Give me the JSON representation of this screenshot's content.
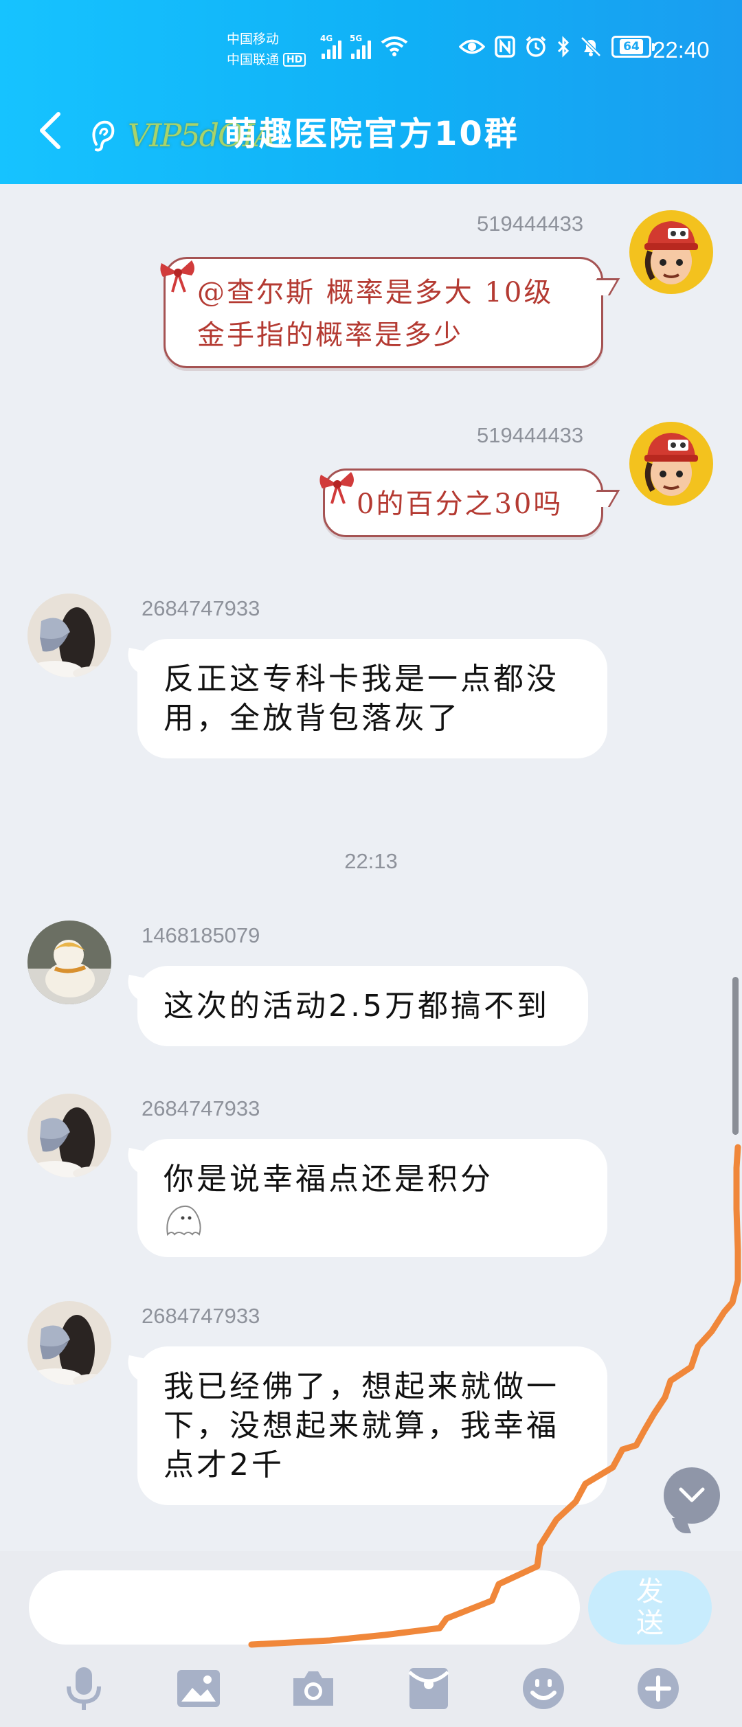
{
  "status_bar": {
    "carrier1": "中国移动",
    "carrier2": "中国联通",
    "hd": "HD",
    "net1": "4G",
    "net2": "5G",
    "battery": "64",
    "time": "22:40"
  },
  "header": {
    "vip_logo": "VIP5dOIA",
    "title": "萌趣医院官方10群"
  },
  "messages": [
    {
      "sender": "519444433",
      "text": "@查尔斯 概率是多大  10级金手指的概率是多少"
    },
    {
      "sender": "519444433",
      "text": "0的百分之30吗"
    },
    {
      "sender": "2684747933",
      "text": "反正这专科卡我是一点都没用，全放背包落灰了"
    },
    {
      "sender": "1468185079",
      "text": "这次的活动2.5万都搞不到"
    },
    {
      "sender": "2684747933",
      "text": "你是说幸福点还是积分"
    },
    {
      "sender": "2684747933",
      "text": "我已经佛了，想起来就做一下，没想起来就算，我幸福点才2千"
    }
  ],
  "time_divider": "22:13",
  "input": {
    "send_label": "发送"
  },
  "colors": {
    "header_gradient_start": "#16c3ff",
    "header_gradient_end": "#1a9df0",
    "chat_bg": "#eceff4",
    "deco_bubble_text": "#b43a32",
    "scribble": "#f0873a",
    "send_button": "#c8ecfd"
  }
}
